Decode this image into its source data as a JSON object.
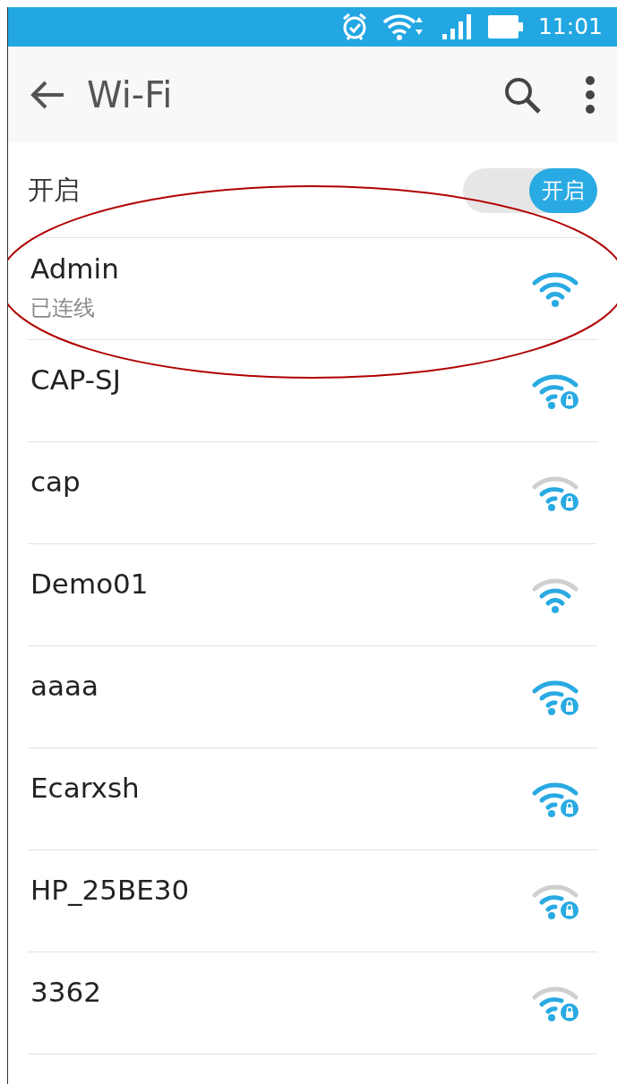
{
  "status_bar": {
    "time": "11:01"
  },
  "app_bar": {
    "title": "Wi-Fi"
  },
  "wifi_switch": {
    "label": "开启",
    "on": true,
    "switch_text": "开启"
  },
  "networks": [
    {
      "name": "Admin",
      "status": "已连线",
      "strong_signal": true,
      "secured": false,
      "highlighted": true
    },
    {
      "name": "CAP-SJ",
      "strong_signal": true,
      "secured": true,
      "highlighted": false
    },
    {
      "name": "cap",
      "strong_signal": false,
      "secured": true,
      "highlighted": false
    },
    {
      "name": "Demo01",
      "strong_signal": false,
      "secured": false,
      "highlighted": false
    },
    {
      "name": "aaaa",
      "strong_signal": true,
      "secured": true,
      "highlighted": false
    },
    {
      "name": "Ecarxsh",
      "strong_signal": true,
      "secured": true,
      "highlighted": false
    },
    {
      "name": "HP_25BE30",
      "strong_signal": false,
      "secured": true,
      "highlighted": false
    },
    {
      "name": "3362",
      "strong_signal": false,
      "secured": true,
      "highlighted": false
    }
  ]
}
